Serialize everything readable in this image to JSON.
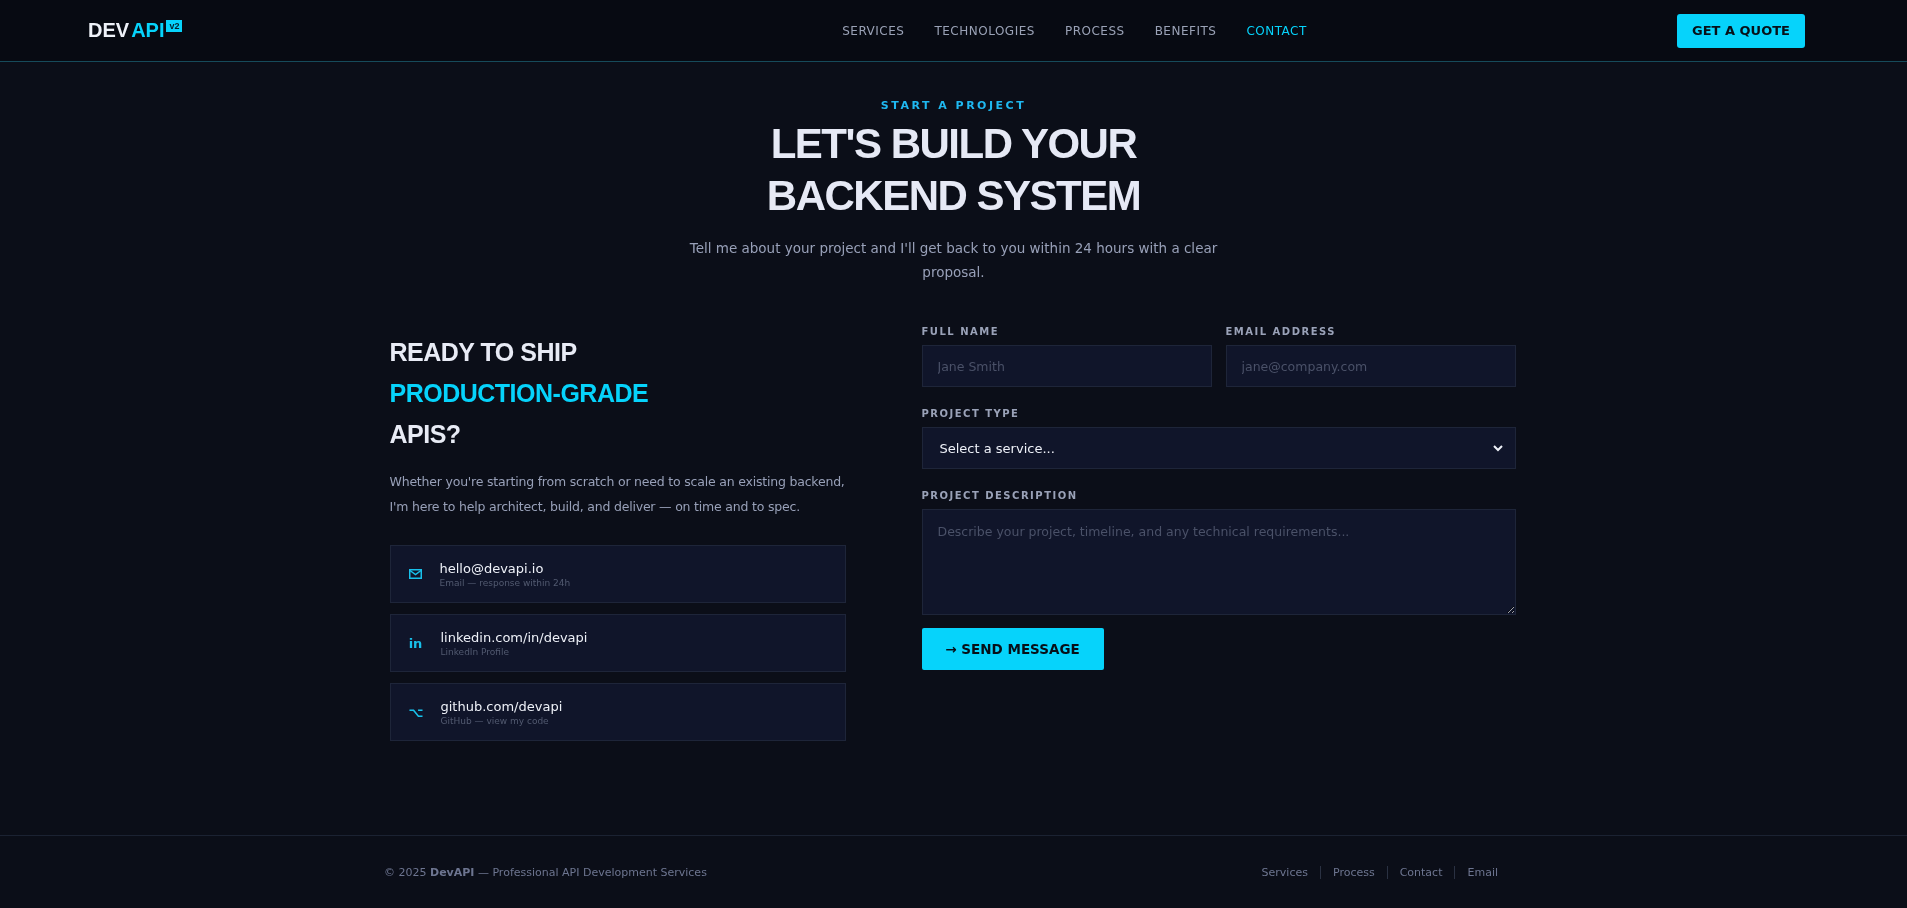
{
  "header": {
    "logo": {
      "part_1": "DEV",
      "part_2": "API",
      "badge": "v2"
    },
    "nav": [
      {
        "label": "SERVICES",
        "selected": false
      },
      {
        "label": "TECHNOLOGIES",
        "selected": false
      },
      {
        "label": "PROCESS",
        "selected": false
      },
      {
        "label": "BENEFITS",
        "selected": false
      },
      {
        "label": "CONTACT",
        "selected": true
      }
    ],
    "cta": "GET A QUOTE"
  },
  "hero": {
    "eyebrow": "START A PROJECT",
    "title_lines": [
      "LET'S BUILD YOUR",
      "BACKEND SYSTEM"
    ],
    "subtitle": "Tell me about your project and I'll get back to you within 24 hours with a clear proposal."
  },
  "intro": {
    "heading_lines": [
      {
        "text": "READY TO SHIP",
        "highlight": false
      },
      {
        "text": "PRODUCTION-GRADE",
        "highlight": true
      },
      {
        "text": "APIS?",
        "highlight": false
      }
    ],
    "text": "Whether you're starting from scratch or need to scale an existing backend, I'm here to help architect, build, and deliver — on time and to spec.",
    "contacts": [
      {
        "kind": "mail",
        "value": "hello@devapi.io",
        "caption": "Email — response within 24h"
      },
      {
        "kind": "linkedin",
        "icon": "in",
        "value": "linkedin.com/in/devapi",
        "caption": "LinkedIn Profile"
      },
      {
        "kind": "github",
        "icon": "⌥",
        "value": "github.com/devapi",
        "caption": "GitHub — view my code"
      }
    ]
  },
  "form": {
    "full_name": {
      "label": "FULL NAME",
      "placeholder": "Jane Smith"
    },
    "email": {
      "label": "EMAIL ADDRESS",
      "placeholder": "jane@company.com"
    },
    "project_type": {
      "label": "PROJECT TYPE",
      "value": "Select a service..."
    },
    "description": {
      "label": "PROJECT DESCRIPTION",
      "placeholder": "Describe your project, timeline, and any technical requirements..."
    },
    "submit": "→ SEND MESSAGE"
  },
  "footer": {
    "copyright": "© 2025 **DevAPI** — Professional API Development Services",
    "links": [
      "Services",
      "Process",
      "Contact",
      "Email"
    ]
  }
}
